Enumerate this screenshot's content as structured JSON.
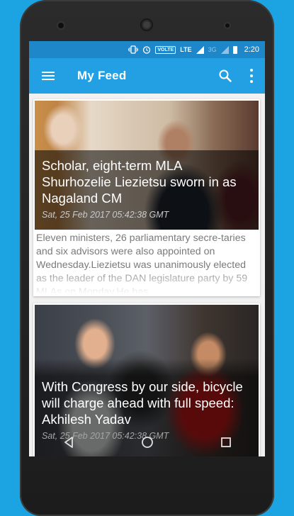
{
  "status_bar": {
    "icons": [
      "vibrate-icon",
      "alarm-icon",
      "volte-badge",
      "lte-signal-icon",
      "3g-signal-icon",
      "battery-icon"
    ],
    "volte_label": "VOLTE",
    "lte_label": "LTE",
    "threeg_label": "3G",
    "time": "2:20"
  },
  "app_bar": {
    "title": "My Feed",
    "icons": [
      "menu-icon",
      "search-icon",
      "more-vert-icon"
    ]
  },
  "feed": {
    "articles": [
      {
        "headline": "Scholar, eight-term MLA Shurhozelie Liezietsu sworn in as Nagaland CM",
        "datetime": "Sat, 25 Feb 2017 05:42:38 GMT",
        "summary": "Eleven ministers, 26 parliamentary secre-taries and six advisors were also appointed on Wednesday.Liezietsu was unanimously elected as the leader of the DAN legislature party by 59 MLAs on Monday.He has"
      },
      {
        "headline": "With Congress by our side, bicycle will charge ahead with full speed: Akhilesh Yadav",
        "datetime": "Sat, 25 Feb 2017 05:42:38 GMT"
      }
    ]
  },
  "nav_bar": {
    "icons": [
      "back-icon",
      "home-icon",
      "recents-icon"
    ]
  },
  "colors": {
    "background": "#1ba3e2",
    "status_bar": "#1e87c9",
    "app_bar": "#22a0e3"
  }
}
